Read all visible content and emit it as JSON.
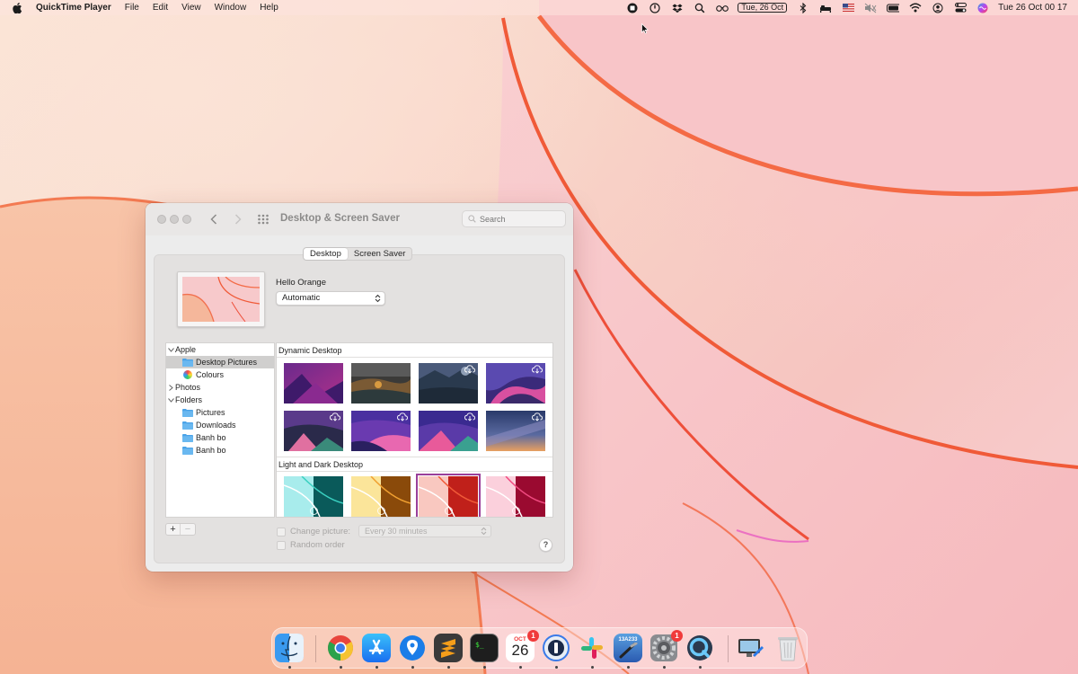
{
  "menubar": {
    "app_name": "QuickTime Player",
    "menus": [
      "File",
      "Edit",
      "View",
      "Window",
      "Help"
    ],
    "date_box": "Tue, 26 Oct",
    "clock": "Tue 26 Oct  00 17",
    "status_icons": [
      "screen-record-icon",
      "power-icon",
      "dropbox-icon",
      "search-icon",
      "glasses-icon",
      "bluetooth-icon",
      "bed-icon",
      "us-flag-icon",
      "mute-icon",
      "battery-icon",
      "wifi-icon",
      "user-icon",
      "control-center-icon",
      "siri-icon"
    ]
  },
  "window": {
    "title": "Desktop & Screen Saver",
    "search_placeholder": "Search",
    "tabs": [
      {
        "label": "Desktop",
        "active": true
      },
      {
        "label": "Screen Saver",
        "active": false
      }
    ],
    "wallpaper_name": "Hello Orange",
    "appearance_value": "Automatic",
    "sidebar": [
      {
        "label": "Apple",
        "level": 0,
        "expanded": true
      },
      {
        "label": "Desktop Pictures",
        "level": 1,
        "selected": true
      },
      {
        "label": "Colours",
        "level": 1
      },
      {
        "label": "Photos",
        "level": 0,
        "expanded": false
      },
      {
        "label": "Folders",
        "level": 0,
        "expanded": true
      },
      {
        "label": "Pictures",
        "level": 1
      },
      {
        "label": "Downloads",
        "level": 1
      },
      {
        "label": "Banh bo",
        "level": 1
      },
      {
        "label": "Banh bo",
        "level": 1
      }
    ],
    "gallery_sections": [
      "Dynamic Desktop",
      "Light and Dark Desktop"
    ],
    "change_picture_label": "Change picture:",
    "interval_value": "Every 30 minutes",
    "random_order_label": "Random order",
    "help_label": "?",
    "add_label": "+",
    "remove_label": "−"
  },
  "dock": {
    "apps": [
      "Finder",
      "Google Chrome",
      "App Store",
      "Maps Pin",
      "Sublime Text",
      "Terminal",
      "Calendar",
      "1Password",
      "Slack",
      "Xcode Beta",
      "System Preferences",
      "QuickTime Player",
      "Screen Sharing",
      "Trash"
    ],
    "calendar_month": "OCT",
    "calendar_day": "26",
    "calendar_badge": "1",
    "sysprefs_badge": "1",
    "xcode_label": "13A233"
  },
  "colors": {
    "accent_selection": "#9a3f9a",
    "wallpaper_orange": "#f25a3a",
    "wallpaper_pink": "#f7c4c6"
  }
}
